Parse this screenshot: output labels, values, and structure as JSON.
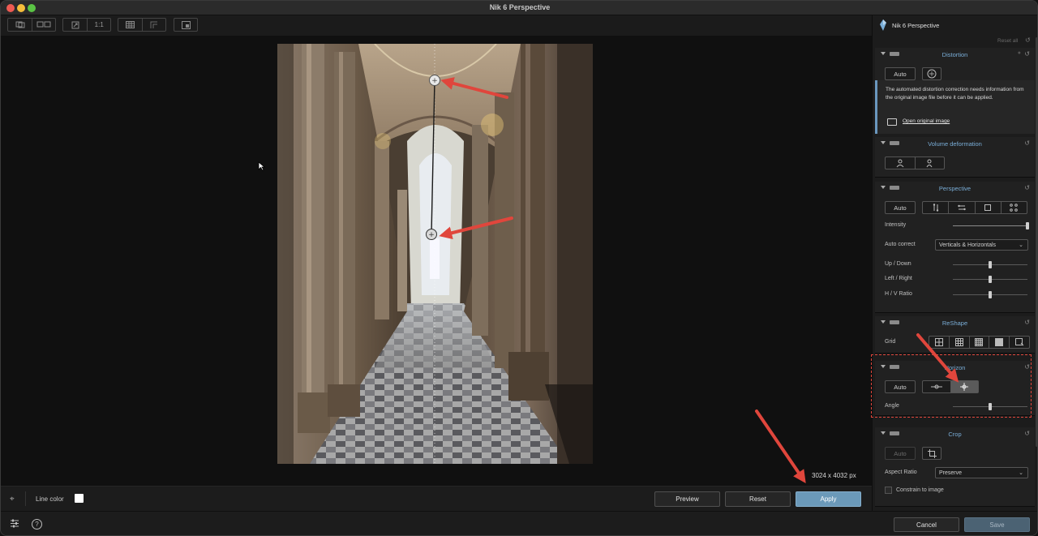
{
  "window": {
    "title": "Nik 6 Perspective"
  },
  "toolbar": {
    "zoom_1to1": "1:1"
  },
  "canvas": {
    "image_dims": "3024 x 4032 px"
  },
  "bottombar": {
    "line_color_label": "Line color",
    "line_color": "#ffffff",
    "preview": "Preview",
    "reset": "Reset",
    "apply": "Apply"
  },
  "footer": {
    "help": "?",
    "cancel": "Cancel",
    "save": "Save"
  },
  "panel": {
    "title": "Nik 6 Perspective",
    "reset_all": "Reset all",
    "distortion": {
      "title": "Distortion",
      "auto": "Auto",
      "info_text": "The automated distortion correction needs information from the original image file before it can be applied.",
      "info_link": "Open original image"
    },
    "volume": {
      "title": "Volume deformation"
    },
    "perspective": {
      "title": "Perspective",
      "auto": "Auto",
      "intensity_label": "Intensity",
      "auto_correct_label": "Auto correct",
      "auto_correct_value": "Verticals & Horizontals",
      "up_down_label": "Up / Down",
      "left_right_label": "Left / Right",
      "hv_ratio_label": "H / V Ratio",
      "intensity": 1.0,
      "up_down": 0.5,
      "left_right": 0.5,
      "hv_ratio": 0.5
    },
    "reshape": {
      "title": "ReShape",
      "grid_label": "Grid"
    },
    "horizon": {
      "title": "Horizon",
      "auto": "Auto",
      "angle_label": "Angle",
      "angle": 0.5
    },
    "crop": {
      "title": "Crop",
      "auto": "Auto",
      "aspect_label": "Aspect Ratio",
      "aspect_value": "Preserve",
      "constrain_label": "Constrain to image"
    }
  },
  "colors": {
    "accent": "#6b99b9",
    "section_title": "#7aaed8",
    "annotation": "#e0463c"
  }
}
